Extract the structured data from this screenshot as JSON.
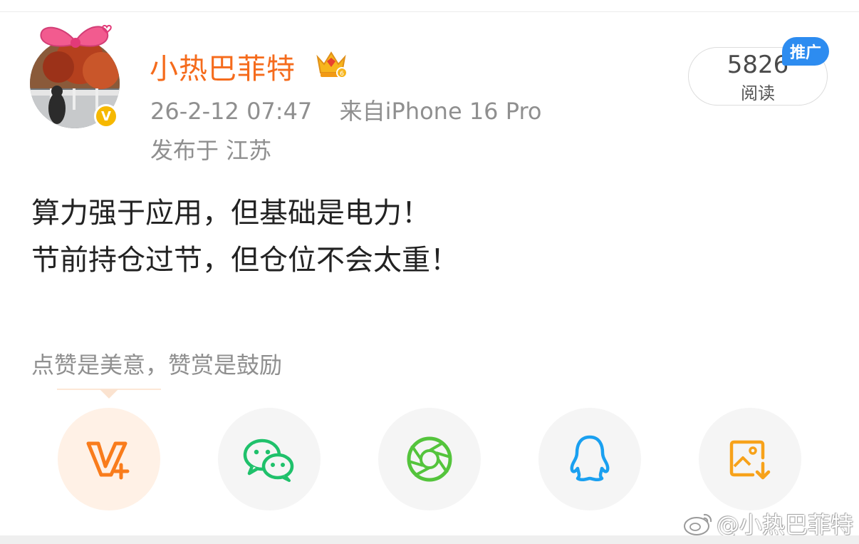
{
  "post": {
    "author": {
      "username": "小热巴菲特",
      "verified_badge": "V",
      "crown_icon": "vip-crown-icon"
    },
    "timestamp": "26-2-12 07:47",
    "source": "来自iPhone 16 Pro",
    "location": "发布于 江苏",
    "reads": {
      "count": "5826",
      "label": "阅读"
    },
    "promo_badge": "推广",
    "content": {
      "lines": [
        "算力强于应用，但基础是电力！",
        "节前持仓过节，但仓位不会太重！"
      ]
    }
  },
  "share": {
    "tip": "点赞是美意，赞赏是鼓励",
    "buttons": [
      {
        "icon": "repost-v-plus-icon",
        "color": "#f97c1c"
      },
      {
        "icon": "wechat-icon",
        "color": "#1fc16b"
      },
      {
        "icon": "moments-icon",
        "color": "#54c43c"
      },
      {
        "icon": "qq-icon",
        "color": "#1aa0f0"
      },
      {
        "icon": "save-image-icon",
        "color": "#f7a21a"
      }
    ]
  },
  "watermark": "@小热巴菲特",
  "colors": {
    "username": "#f56b1c",
    "meta_text": "#8f8f8f",
    "promo": "#2d8cf0",
    "verified": "#f6b800"
  }
}
